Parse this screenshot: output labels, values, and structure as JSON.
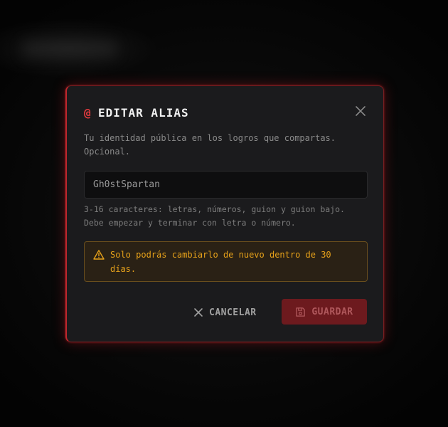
{
  "modal": {
    "title": "EDITAR ALIAS",
    "title_icon": "@",
    "description": "Tu identidad pública en los logros que compartas. Opcional.",
    "input": {
      "value": "Gh0stSpartan",
      "placeholder": ""
    },
    "hint": "3-16 caracteres: letras, números, guion y guion bajo. Debe empezar y terminar con letra o número.",
    "warning": "Solo podrás cambiarlo de nuevo dentro de 30 días.",
    "cancel_label": "CANCELAR",
    "save_label": "GUARDAR"
  },
  "icons": {
    "title": "at-icon",
    "close": "close-icon",
    "warning": "warning-triangle-icon",
    "cancel": "x-icon",
    "save": "floppy-disk-icon"
  },
  "colors": {
    "accent": "#e33b3f",
    "warning": "#e6a11a",
    "save_bg": "#6d1a1e"
  }
}
